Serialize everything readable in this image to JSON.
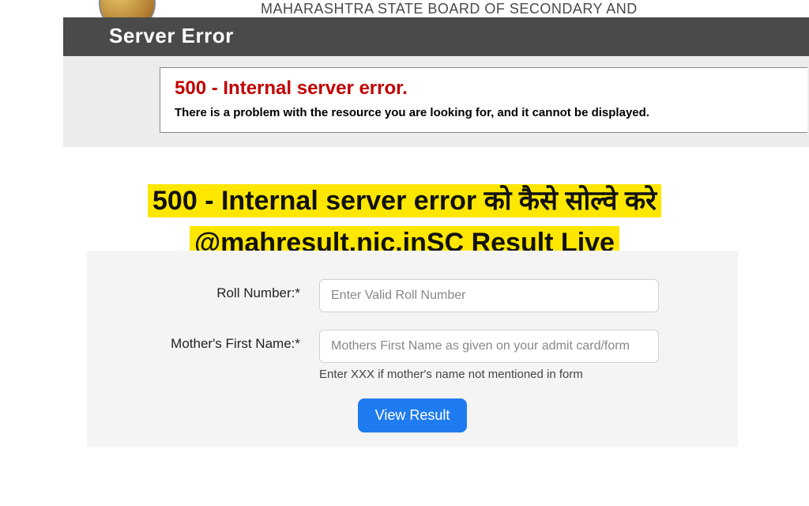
{
  "header": {
    "board_title": "MAHARASHTRA STATE BOARD OF SECONDARY AND"
  },
  "error_bar": {
    "title": "Server Error"
  },
  "error_box": {
    "code": "500 - Internal server error.",
    "message": "There is a problem with the resource you are looking for, and it cannot be displayed."
  },
  "headline": {
    "text": "500 - Internal server error को कैसे सोल्वे करे @mahresult.nic.inSC Result Live"
  },
  "form": {
    "roll_label": "Roll Number:*",
    "roll_placeholder": "Enter Valid Roll Number",
    "mother_label": "Mother's First Name:*",
    "mother_placeholder": "Mothers First Name as given on your admit card/form",
    "hint": "Enter XXX if mother's name not mentioned in form",
    "button_label": "View Result"
  }
}
